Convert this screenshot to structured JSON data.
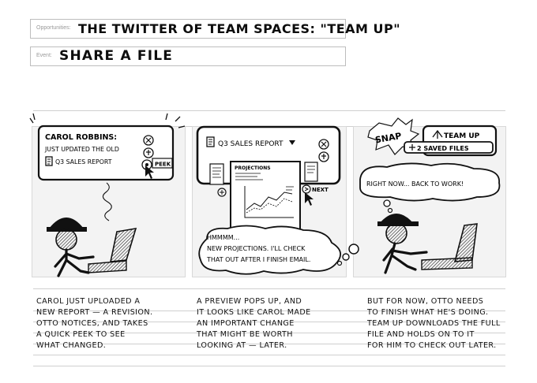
{
  "header": {
    "opportunities_label": "Opportunities:",
    "opportunities_value": "THE TWITTER OF TEAM SPACES: \"TEAM UP\"",
    "event_label": "Event:",
    "event_value": "SHARE A FILE"
  },
  "panels": [
    {
      "notification": {
        "name": "CAROL ROBBINS:",
        "line2": "JUST UPDATED THE OLD",
        "file": "Q3 SALES REPORT",
        "peek_label": "PEEK"
      },
      "caption": [
        "CAROL JUST UPLOADED A",
        "NEW REPORT — A REVISION.",
        "OTTO NOTICES, AND TAKES",
        "A QUICK PEEK TO SEE",
        "WHAT CHANGED."
      ]
    },
    {
      "preview": {
        "title": "Q3 SALES REPORT",
        "doc_heading": "PROJECTIONS",
        "next_label": "NEXT"
      },
      "thought": [
        "HMMMM...",
        "NEW PROJECTIONS. I'LL CHECK",
        "THAT OUT AFTER I FINISH EMAIL."
      ],
      "caption": [
        "A PREVIEW POPS UP, AND",
        "IT LOOKS LIKE CAROL MADE",
        "AN IMPORTANT CHANGE",
        "THAT MIGHT BE WORTH",
        "LOOKING AT — LATER."
      ]
    },
    {
      "snap_label": "SNAP",
      "teamup_label": "TEAM UP",
      "saved_files": "2 SAVED FILES",
      "thought": "RIGHT NOW... BACK TO WORK!",
      "caption": [
        "BUT FOR NOW, OTTO NEEDS",
        "TO FINISH WHAT HE'S DOING.",
        "TEAM UP DOWNLOADS THE FULL",
        "FILE AND HOLDS ON TO IT",
        "FOR HIM TO CHECK OUT LATER."
      ]
    }
  ]
}
